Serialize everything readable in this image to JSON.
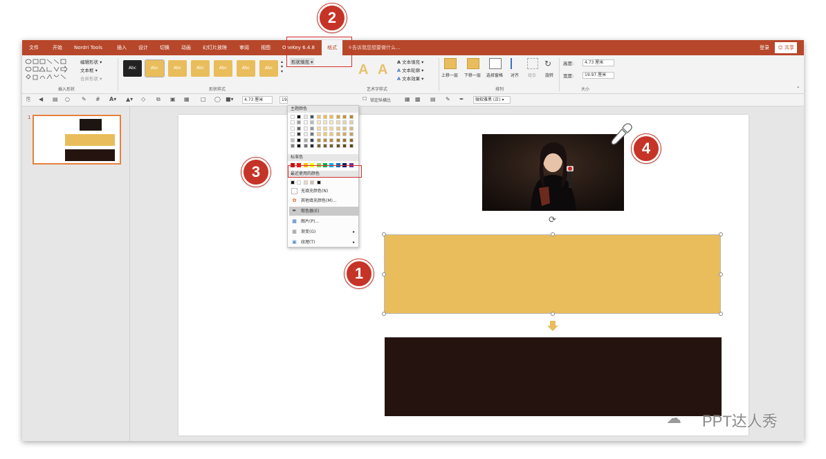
{
  "tabs": {
    "file": "文件",
    "home": "开始",
    "nordri": "Nordri Tools",
    "insert": "插入",
    "design": "设计",
    "transitions": "切换",
    "animations": "动画",
    "slideshow": "幻灯片放映",
    "review": "审阅",
    "view": "视图",
    "onekey": "OneKey 6.4.8",
    "format": "格式"
  },
  "tell_me": "告诉我您想要做什么...",
  "login": "登录",
  "share": "共享",
  "ribbon": {
    "insert_shapes": {
      "label": "插入形状",
      "edit_shape": "编辑形状 ▾",
      "text_box": "文本框 ▾",
      "merge_shapes": "合并形状 ▾"
    },
    "shape_styles": {
      "label": "形状样式",
      "style_sample_text": "Abc",
      "shape_fill": "形状填充 ▾"
    },
    "wordart": {
      "label": "艺术字样式",
      "text_fill": "文本填充 ▾",
      "text_outline": "文本轮廓 ▾",
      "text_effects": "文本效果 ▾"
    },
    "arrange": {
      "label": "排列",
      "bring_forward": "上移一层",
      "send_backward": "下移一层",
      "selection_pane": "选择窗格",
      "align": "对齐",
      "group": "组合",
      "rotate": "旋转"
    },
    "size": {
      "label": "大小",
      "height_label": "高度:",
      "height_value": "4.73 厘米",
      "width_label": "宽度:",
      "width_value": "19.97 厘米"
    }
  },
  "quickbar": {
    "height_value": "4.73 厘米",
    "width_value_partial": "19.",
    "lock_ratio": "锁定纵横比",
    "font_name": "微软雅黑 (正) ▾"
  },
  "slides_panel": {
    "slide_number": "1"
  },
  "menu": {
    "theme_colors": "主题颜色",
    "standard_colors": "标准色",
    "recent_colors": "最近使用的颜色",
    "no_fill": "无填充颜色(N)",
    "more_colors": "其他填充颜色(M)...",
    "eyedropper": "取色器(E)",
    "picture": "图片(P)...",
    "gradient": "渐变(G)",
    "texture": "纹理(T)"
  },
  "callouts": {
    "one": "1",
    "two": "2",
    "three": "3",
    "four": "4"
  },
  "watermark": "PPT达人秀",
  "colors": {
    "accent": "#b7472a",
    "fill_yellow": "#e9bd5b",
    "fill_dark": "#24130f",
    "marker_red": "#c63327",
    "highlight_red": "#d32f2f"
  }
}
